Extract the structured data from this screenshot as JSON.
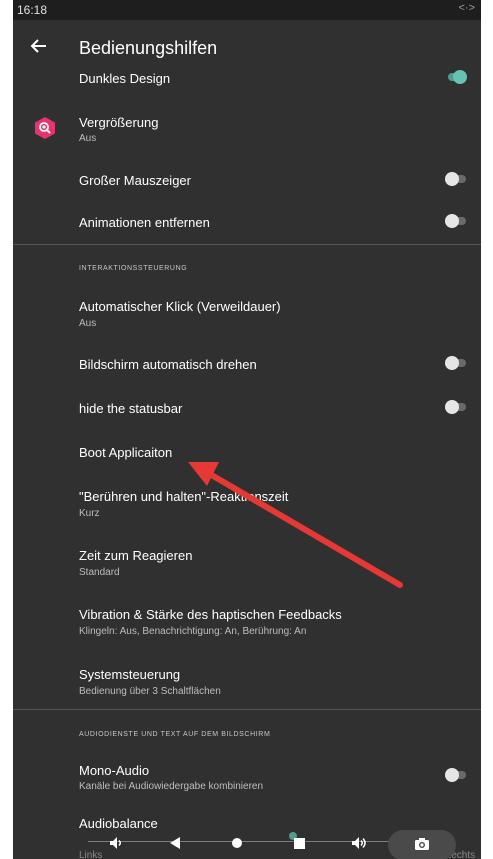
{
  "status": {
    "time": "16:18",
    "icon": "<·>"
  },
  "header": {
    "title": "Bedienungshilfen"
  },
  "items": {
    "dark_design": {
      "label": "Dunkles Design"
    },
    "magnification": {
      "label": "Vergrößerung",
      "summary": "Aus"
    },
    "large_pointer": {
      "label": "Großer Mauszeiger"
    },
    "remove_animations": {
      "label": "Animationen entfernen"
    },
    "section_interaction": "INTERAKTIONSSTEUERUNG",
    "auto_click": {
      "label": "Automatischer Klick (Verweildauer)",
      "summary": "Aus"
    },
    "auto_rotate": {
      "label": "Bildschirm automatisch drehen"
    },
    "hide_statusbar": {
      "label": "hide the statusbar"
    },
    "boot_app": {
      "label": "Boot Applicaiton"
    },
    "touch_hold": {
      "label": "\"Berühren und halten\"-Reaktionszeit",
      "summary": "Kurz"
    },
    "time_to_react": {
      "label": "Zeit zum Reagieren",
      "summary": "Standard"
    },
    "vibration": {
      "label": "Vibration & Stärke des haptischen Feedbacks",
      "summary": "Klingeln: Aus, Benachrichtigung: An, Berührung: An"
    },
    "system_nav": {
      "label": "Systemsteuerung",
      "summary": "Bedienung über 3 Schaltflächen"
    },
    "section_audio": "AUDIODIENSTE UND TEXT AUF DEM BILDSCHIRM",
    "mono_audio": {
      "label": "Mono-Audio",
      "summary": "Kanäle bei Audiowiedergabe kombinieren"
    },
    "audio_balance": {
      "label": "Audiobalance",
      "left": "Links",
      "right": "Rechts"
    }
  },
  "toggles": {
    "dark_design": true,
    "large_pointer": false,
    "remove_animations": false,
    "auto_rotate": false,
    "hide_statusbar": false,
    "mono_audio": false
  },
  "colors": {
    "background": "#303030",
    "accent_toggle": "#66c2b3",
    "magnification_icon": "#e8336d",
    "annotation_arrow": "#e53935"
  },
  "icons": {
    "back": "arrow-left-icon",
    "magnification": "magnify-icon",
    "nav": [
      "volume-down-icon",
      "back-triangle-icon",
      "home-circle-icon",
      "recents-square-icon",
      "volume-up-icon",
      "screenshot-camera-icon"
    ]
  }
}
